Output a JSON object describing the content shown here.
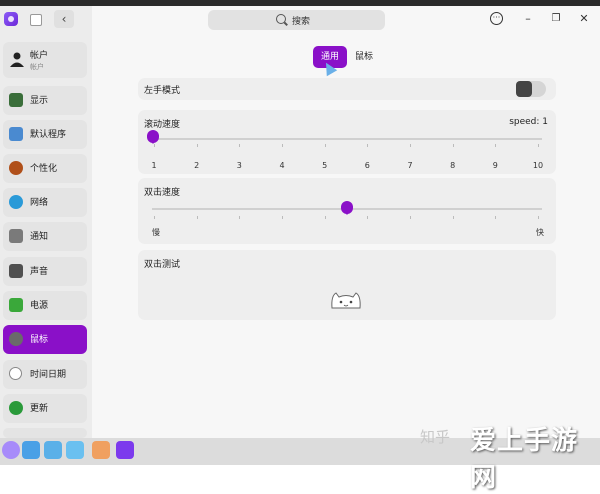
{
  "header": {
    "search_label": "搜索"
  },
  "sidebar": {
    "account": {
      "label": "帐户",
      "sub": "帐户"
    },
    "items": [
      {
        "label": "显示",
        "icon": "display-icon",
        "color": "#3a6e3a"
      },
      {
        "label": "默认程序",
        "icon": "default-apps-icon",
        "color": "#4a8ad0"
      },
      {
        "label": "个性化",
        "icon": "personalization-icon",
        "color": "#b0501a"
      },
      {
        "label": "网络",
        "icon": "network-icon",
        "color": "#2a9ad8"
      },
      {
        "label": "通知",
        "icon": "notification-icon",
        "color": "#7a7a7a"
      },
      {
        "label": "声音",
        "icon": "sound-icon",
        "color": "#505050"
      },
      {
        "label": "电源",
        "icon": "power-icon",
        "color": "#3aa83a"
      },
      {
        "label": "鼠标",
        "icon": "mouse-icon",
        "color": "#6a6a6a"
      },
      {
        "label": "时间日期",
        "icon": "clock-icon",
        "color": "#888888"
      },
      {
        "label": "更新",
        "icon": "update-icon",
        "color": "#2a9a3a"
      }
    ]
  },
  "tabs": {
    "general": "通用",
    "mouse": "鼠标"
  },
  "left_hand": {
    "label": "左手模式",
    "enabled": false
  },
  "scroll_speed": {
    "label": "滚动速度",
    "value_label": "speed: 1",
    "ticks": [
      "1",
      "2",
      "3",
      "4",
      "5",
      "6",
      "7",
      "8",
      "9",
      "10"
    ],
    "value": 1
  },
  "double_click_speed": {
    "label": "双击速度",
    "min_label": "慢",
    "max_label": "快",
    "value": 0.5
  },
  "double_click_test": {
    "label": "双击测试"
  },
  "watermark": {
    "text": "知乎",
    "logo": "爱上手游网"
  },
  "accent": "#8a10c8"
}
